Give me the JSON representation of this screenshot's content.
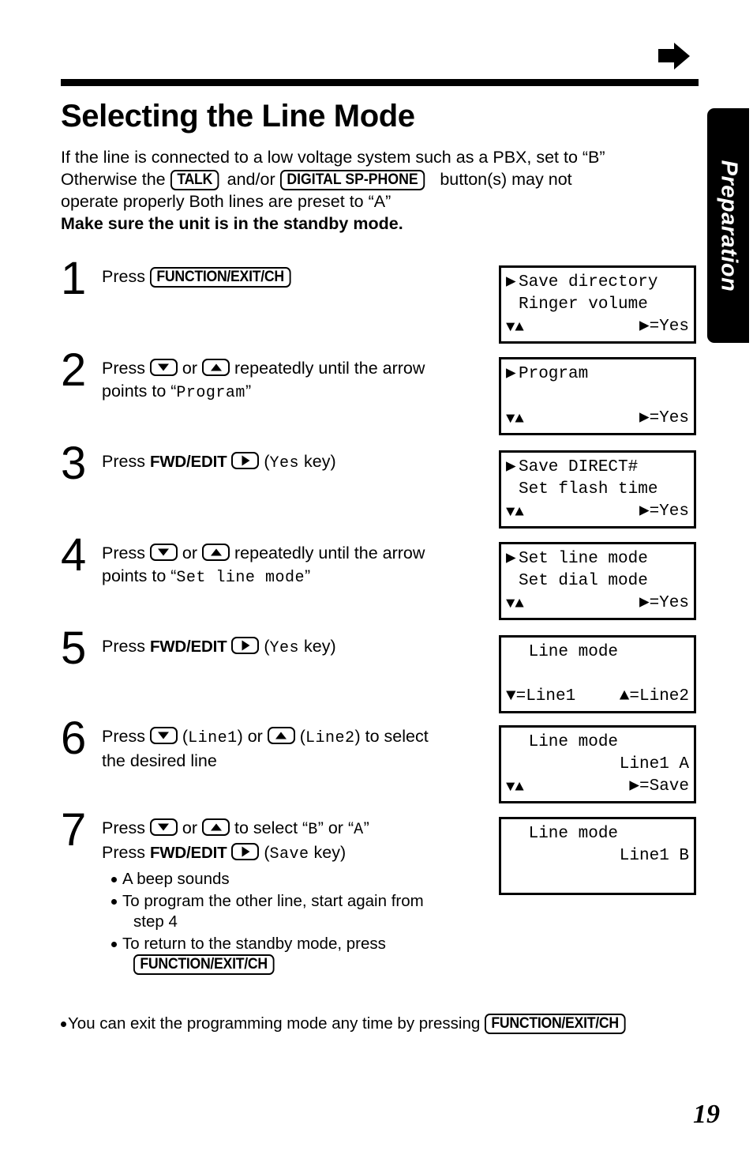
{
  "page": {
    "title": "Selecting the Line Mode",
    "number": "19",
    "side_tab": "Preparation",
    "top_marker_icon": "right-arrow-icon"
  },
  "intro": {
    "line1_a": "If the line is connected to a low voltage system such as a PBX, set to “B”",
    "line2_a": "Otherwise the ",
    "line2_key1": "TALK",
    "line2_b": " and/or ",
    "line2_key2": "DIGITAL  SP-PHONE",
    "line2_c": " button(s) may not",
    "line3": "operate properly  Both lines are preset to “A”",
    "line4_bold": "Make sure the unit is in the standby mode."
  },
  "steps": [
    {
      "num": "1",
      "line1_a": "Press ",
      "key": "FUNCTION/EXIT/CH"
    },
    {
      "num": "2",
      "line1_a": "Press ",
      "key_down": "down-arrow-key",
      "line1_b": " or ",
      "key_up": "up-arrow-key",
      "line1_c": " repeatedly until the arrow",
      "line2_a": "points to “",
      "line2_mono": "Program",
      "line2_b": "”"
    },
    {
      "num": "3",
      "line1_a": "Press ",
      "label": "FWD/EDIT",
      "key_right": "right-arrow-key",
      "line1_b": " (",
      "mono": "Yes",
      "line1_c": " key)"
    },
    {
      "num": "4",
      "line1_a": "Press ",
      "key_down": "down-arrow-key",
      "line1_b": " or ",
      "key_up": "up-arrow-key",
      "line1_c": " repeatedly until the arrow",
      "line2_a": "points to “",
      "line2_mono": "Set line mode",
      "line2_b": "”"
    },
    {
      "num": "5",
      "line1_a": "Press ",
      "label": "FWD/EDIT",
      "key_right": "right-arrow-key",
      "line1_b": " (",
      "mono": "Yes",
      "line1_c": " key)"
    },
    {
      "num": "6",
      "line1_a": "Press ",
      "key_down": "down-arrow-key",
      "line1_b": " (",
      "mono1": "Line1",
      "line1_c": ") or ",
      "key_up": "up-arrow-key",
      "line1_d": " (",
      "mono2": "Line2",
      "line1_e": ") to select",
      "line2": "the desired line"
    },
    {
      "num": "7",
      "line1_a": "Press ",
      "key_down": "down-arrow-key",
      "line1_b": " or ",
      "key_up": "up-arrow-key",
      "line1_c": " to select “",
      "line1_mono1": "B",
      "line1_d": "” or “",
      "line1_mono2": "A",
      "line1_e": "”",
      "line2_a": "Press ",
      "label": "FWD/EDIT",
      "key_right": "right-arrow-key",
      "line2_b": " (",
      "line2_mono": "Save",
      "line2_c": " key)",
      "bullets": [
        "A beep sounds",
        "To program the other line, start again from",
        "To return to the standby mode, press"
      ],
      "bullet2_cont": "step 4",
      "bullet3_key": "FUNCTION/EXIT/CH"
    }
  ],
  "displays": [
    {
      "id": "display-step-1",
      "row1_marker": "▶",
      "row1": "Save directory",
      "row2_marker": "",
      "row2": "Ringer volume",
      "row3_left": "▼▲",
      "row3_right": "▶=Yes"
    },
    {
      "id": "display-step-2",
      "row1_marker": "▶",
      "row1": "Program",
      "row2_marker": "",
      "row2": "",
      "row3_left": "▼▲",
      "row3_right": "▶=Yes"
    },
    {
      "id": "display-step-3",
      "row1_marker": "▶",
      "row1": "Save DIRECT#",
      "row2_marker": "",
      "row2": "Set flash time",
      "row3_left": "▼▲",
      "row3_right": "▶=Yes"
    },
    {
      "id": "display-step-4",
      "row1_marker": "▶",
      "row1": "Set line mode",
      "row2_marker": "",
      "row2": "Set dial mode",
      "row3_left": "▼▲",
      "row3_right": "▶=Yes"
    },
    {
      "id": "display-step-5",
      "row1_marker": "",
      "row1": " Line mode",
      "row2_marker": "",
      "row2": "",
      "row3_left": "▼=Line1",
      "row3_right": "▲=Line2"
    },
    {
      "id": "display-step-6",
      "row1_marker": "",
      "row1": " Line mode",
      "row2_marker": "",
      "row2_right": "Line1 A",
      "row3_left": "▼▲",
      "row3_right": "▶=Save"
    },
    {
      "id": "display-step-7",
      "row1_marker": "",
      "row1": " Line mode",
      "row2_marker": "",
      "row2_right": "Line1 B",
      "row3_left": "",
      "row3_right": ""
    }
  ],
  "footer": {
    "note_a": "You can exit the programming mode any time by pressing ",
    "note_key": "FUNCTION/EXIT/CH"
  }
}
